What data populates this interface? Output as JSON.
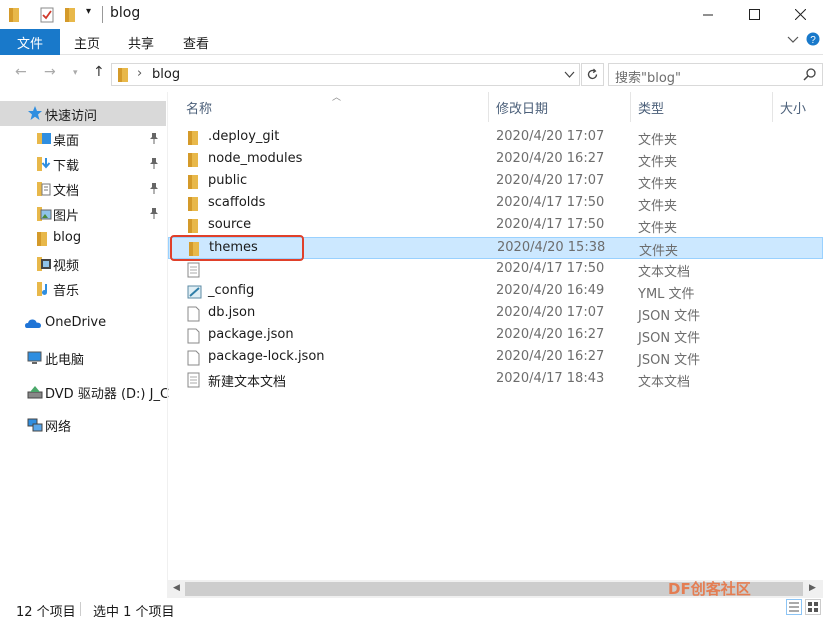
{
  "window": {
    "title": "blog",
    "colors": {
      "accent": "#1979ca",
      "selected_row": "#cce8ff",
      "highlight_box": "#e0402a",
      "folder": "#e8b84a"
    }
  },
  "ribbon": {
    "file_tab": "文件",
    "tabs": [
      "主页",
      "共享",
      "查看"
    ]
  },
  "address": {
    "path": "blog",
    "search_placeholder": "搜索\"blog\""
  },
  "nav": {
    "quick_access": "快速访问",
    "items": [
      {
        "label": "桌面",
        "icon": "desktop-icon",
        "pinned": true
      },
      {
        "label": "下载",
        "icon": "download-icon",
        "pinned": true
      },
      {
        "label": "文档",
        "icon": "documents-icon",
        "pinned": true
      },
      {
        "label": "图片",
        "icon": "pictures-icon",
        "pinned": true
      },
      {
        "label": "blog",
        "icon": "folder-icon",
        "pinned": false
      },
      {
        "label": "视频",
        "icon": "videos-icon",
        "pinned": false
      },
      {
        "label": "音乐",
        "icon": "music-icon",
        "pinned": false
      }
    ],
    "onedrive": "OneDrive",
    "this_pc": "此电脑",
    "dvd": "DVD 驱动器 (D:) J_C",
    "network": "网络"
  },
  "columns": {
    "name": "名称",
    "date": "修改日期",
    "type": "类型",
    "size": "大小"
  },
  "files": [
    {
      "name": ".deploy_git",
      "date": "2020/4/20 17:07",
      "type": "文件夹",
      "icon": "folder"
    },
    {
      "name": "node_modules",
      "date": "2020/4/20 16:27",
      "type": "文件夹",
      "icon": "folder"
    },
    {
      "name": "public",
      "date": "2020/4/20 17:07",
      "type": "文件夹",
      "icon": "folder"
    },
    {
      "name": "scaffolds",
      "date": "2020/4/17 17:50",
      "type": "文件夹",
      "icon": "folder"
    },
    {
      "name": "source",
      "date": "2020/4/17 17:50",
      "type": "文件夹",
      "icon": "folder"
    },
    {
      "name": "themes",
      "date": "2020/4/20 15:38",
      "type": "文件夹",
      "icon": "folder",
      "selected": true
    },
    {
      "name": "",
      "date": "2020/4/17 17:50",
      "type": "文本文档",
      "icon": "text"
    },
    {
      "name": "_config",
      "date": "2020/4/20 16:49",
      "type": "YML 文件",
      "icon": "yml"
    },
    {
      "name": "db.json",
      "date": "2020/4/20 17:07",
      "type": "JSON 文件",
      "icon": "file"
    },
    {
      "name": "package.json",
      "date": "2020/4/20 16:27",
      "type": "JSON 文件",
      "icon": "file"
    },
    {
      "name": "package-lock.json",
      "date": "2020/4/20 16:27",
      "type": "JSON 文件",
      "icon": "file"
    },
    {
      "name": "新建文本文档",
      "date": "2020/4/17 18:43",
      "type": "文本文档",
      "icon": "text"
    }
  ],
  "status": {
    "item_count": "12 个项目",
    "selected": "选中 1 个项目"
  },
  "watermark": "DF创客社区"
}
